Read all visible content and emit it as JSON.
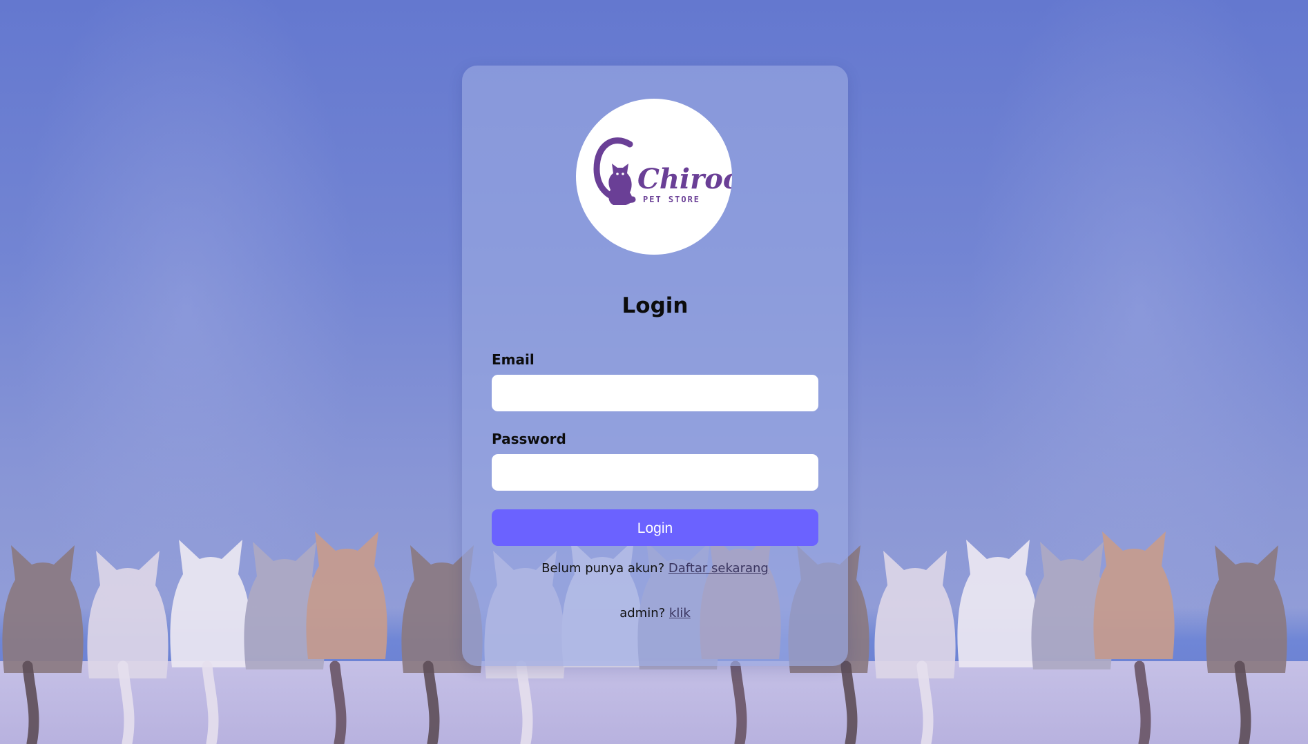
{
  "colors": {
    "background": "#6a7fd2",
    "card": "#98a6e0",
    "primary_button": "#6b62ff",
    "logo_purple": "#6a3f96"
  },
  "background": {
    "icons": [
      "cats-on-wall-photo-icon"
    ]
  },
  "logo": {
    "brand_name": "Chiroo",
    "tagline": "PET STORE",
    "icon": "cat-logo-icon"
  },
  "login": {
    "title": "Login",
    "email_label": "Email",
    "email_value": "",
    "password_label": "Password",
    "password_value": "",
    "submit_label": "Login",
    "register_prompt": "Belum punya akun?",
    "register_link": "Daftar sekarang",
    "admin_prompt": "admin?",
    "admin_link": "klik"
  }
}
